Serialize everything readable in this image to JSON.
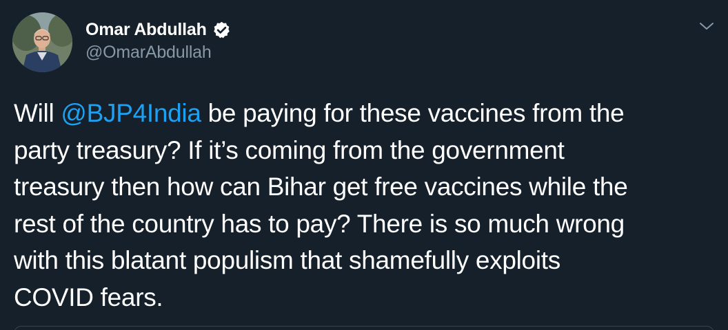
{
  "author": {
    "name": "Omar Abdullah",
    "handle": "@OmarAbdullah",
    "verified": true
  },
  "tweet": {
    "lines": [
      {
        "before": "Will ",
        "mention": "@BJP4India",
        "after": " be paying for these vaccines from the"
      },
      {
        "text": "party treasury? If it’s coming from the government"
      },
      {
        "text": "treasury then how can Bihar get free vaccines while the"
      },
      {
        "text": "rest of the country has to pay? There is so much wrong"
      },
      {
        "text": "with this blatant populism that shamefully exploits"
      },
      {
        "text": "COVID fears."
      }
    ]
  },
  "icons": {
    "verified": "verified-badge-icon",
    "menu": "chevron-down-icon"
  },
  "colors": {
    "background": "#15202b",
    "text": "#ffffff",
    "secondary_text": "#8899a6",
    "mention": "#1da1f2",
    "border": "#38444d"
  }
}
